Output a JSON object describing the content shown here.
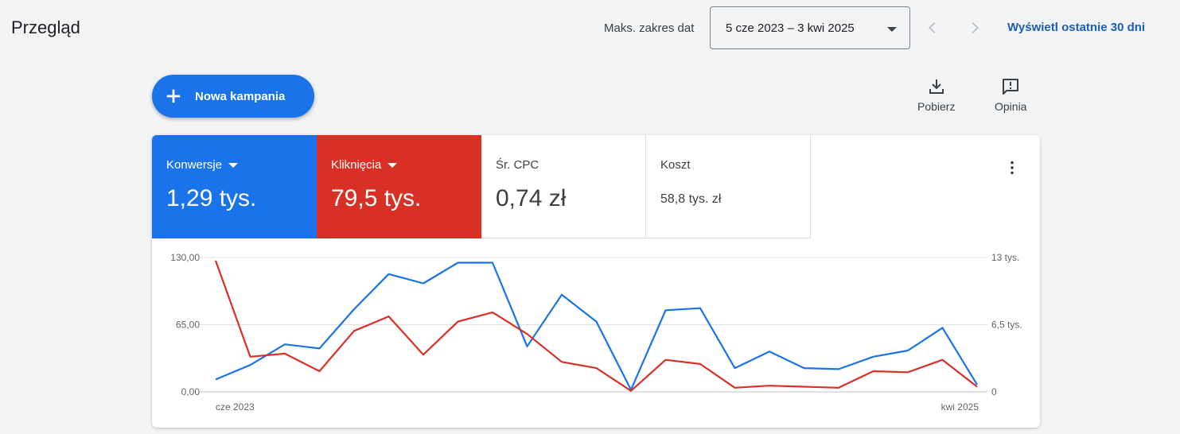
{
  "header": {
    "title": "Przegląd",
    "date_range_label": "Maks. zakres dat",
    "date_range_value": "5 cze 2023 – 3 kwi 2025",
    "last30_label": "Wyświetl ostatnie 30 dni"
  },
  "toolbar": {
    "new_campaign_label": "Nowa kampania",
    "download_label": "Pobierz",
    "feedback_label": "Opinia"
  },
  "metrics": [
    {
      "name": "Konwersje",
      "value": "1,29 tys.",
      "color": "#1a73e8"
    },
    {
      "name": "Kliknięcia",
      "value": "79,5 tys.",
      "color": "#d93025"
    },
    {
      "name": "Śr. CPC",
      "value": "0,74 zł"
    },
    {
      "name": "Koszt",
      "value": "58,8 tys. zł"
    }
  ],
  "chart_data": {
    "type": "line",
    "x_start_label": "cze 2023",
    "x_end_label": "kwi 2025",
    "left_ticks": [
      "130,00",
      "65,00",
      "0,00"
    ],
    "right_ticks": [
      "13 tys.",
      "6,5 tys.",
      "0"
    ],
    "ylim_left": [
      0,
      130
    ],
    "ylim_right": [
      0,
      13000
    ],
    "grid": true,
    "series": [
      {
        "name": "Konwersje",
        "axis": "left",
        "color": "#1a73e8",
        "values": [
          12,
          26,
          46,
          42,
          80,
          114,
          105,
          125,
          125,
          44,
          94,
          68,
          2,
          79,
          81,
          23,
          39,
          23,
          22,
          34,
          40,
          62,
          7
        ]
      },
      {
        "name": "Kliknięcia",
        "axis": "right",
        "color": "#d93025",
        "values": [
          12700,
          3400,
          3700,
          2000,
          5900,
          7300,
          3600,
          6800,
          7700,
          5600,
          2900,
          2300,
          100,
          3100,
          2700,
          400,
          600,
          500,
          400,
          2000,
          1900,
          3100,
          500
        ]
      }
    ]
  }
}
